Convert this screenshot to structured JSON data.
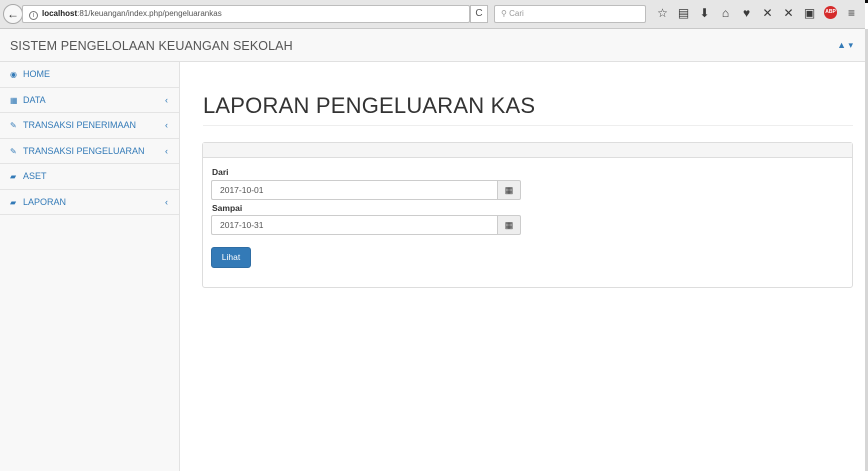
{
  "browser": {
    "back_glyph": "←",
    "url_host": "localhost",
    "url_rest": ":81/keuangan/index.php/pengeluarankas",
    "reload_glyph": "C",
    "search_placeholder": "Cari"
  },
  "navbar": {
    "brand": "SISTEM PENGELOLAAN KEUANGAN SEKOLAH",
    "user_glyph": "▲ ▾"
  },
  "sidebar": {
    "items": [
      {
        "icon": "dashboard-icon",
        "label": "HOME",
        "has_arrow": false
      },
      {
        "icon": "table-icon",
        "label": "DATA",
        "has_arrow": true
      },
      {
        "icon": "edit-icon",
        "label": "TRANSAKSI PENERIMAAN",
        "has_arrow": true
      },
      {
        "icon": "edit-icon",
        "label": "TRANSAKSI PENGELUARAN",
        "has_arrow": true
      },
      {
        "icon": "file-icon",
        "label": "ASET",
        "has_arrow": false
      },
      {
        "icon": "file-icon",
        "label": "LAPORAN",
        "has_arrow": true
      }
    ],
    "arrow_glyph": "‹"
  },
  "main": {
    "title": "LAPORAN PENGELUARAN KAS",
    "form": {
      "from_label": "Dari",
      "from_value": "2017-10-01",
      "to_label": "Sampai",
      "to_value": "2017-10-31",
      "submit_label": "Lihat"
    }
  },
  "colors": {
    "link": "#337ab7",
    "button": "#337ab7"
  }
}
